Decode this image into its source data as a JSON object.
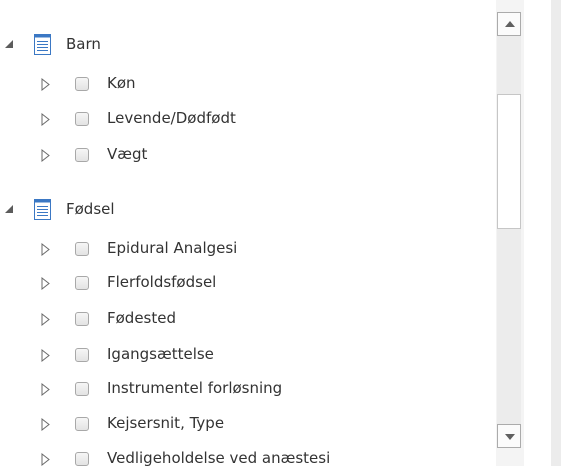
{
  "tree": {
    "groups": [
      {
        "label": "Barn",
        "expanded": true,
        "icon": "document-list-icon",
        "items": [
          {
            "label": "Køn"
          },
          {
            "label": "Levende/Dødfødt"
          },
          {
            "label": "Vægt"
          }
        ]
      },
      {
        "label": "Fødsel",
        "expanded": true,
        "icon": "document-list-icon",
        "items": [
          {
            "label": "Epidural Analgesi"
          },
          {
            "label": "Flerfoldsfødsel"
          },
          {
            "label": "Fødested"
          },
          {
            "label": "Igangsættelse"
          },
          {
            "label": "Instrumentel forløsning"
          },
          {
            "label": "Kejsersnit, Type"
          },
          {
            "label": "Vedligeholdelse ved anæstesi"
          }
        ]
      }
    ]
  },
  "colors": {
    "text": "#333333",
    "icon_blue": "#3b78c4",
    "scrollbar_track": "#ececec",
    "checkbox_border": "#a8a8a8"
  }
}
